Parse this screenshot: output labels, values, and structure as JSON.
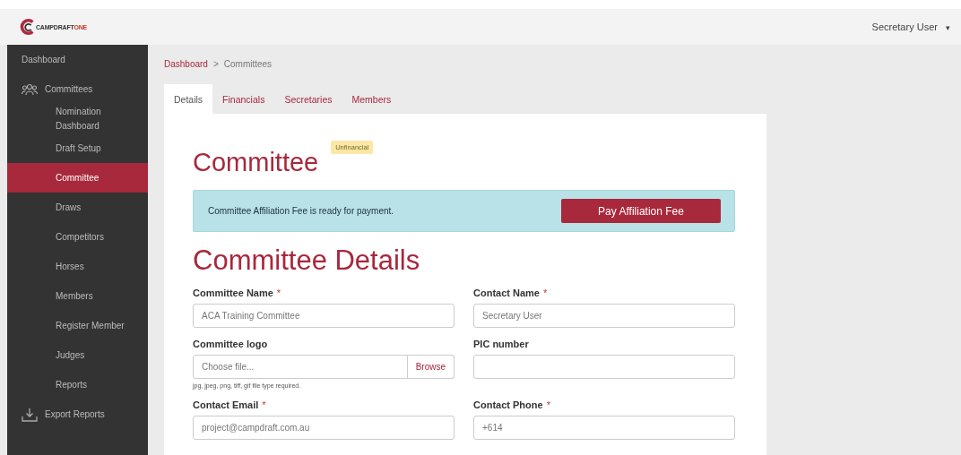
{
  "logo": {
    "text": "CAMPDRAFT",
    "accent": "ONE"
  },
  "user_menu": {
    "label": "Secretary User",
    "caret": "▾"
  },
  "sidebar": {
    "items": [
      {
        "label": "Dashboard",
        "kind": "plain",
        "selected": false
      },
      {
        "label": "Committees",
        "kind": "group",
        "selected": false
      },
      {
        "label": "Nomination Dashboard",
        "kind": "sub",
        "selected": false
      },
      {
        "label": "Draft Setup",
        "kind": "sub",
        "selected": false
      },
      {
        "label": "Committee",
        "kind": "sub",
        "selected": true
      },
      {
        "label": "Draws",
        "kind": "sub",
        "selected": false
      },
      {
        "label": "Competitors",
        "kind": "sub",
        "selected": false
      },
      {
        "label": "Horses",
        "kind": "sub",
        "selected": false
      },
      {
        "label": "Members",
        "kind": "sub",
        "selected": false
      },
      {
        "label": "Register Member",
        "kind": "sub",
        "selected": false
      },
      {
        "label": "Judges",
        "kind": "sub",
        "selected": false
      },
      {
        "label": "Reports",
        "kind": "sub",
        "selected": false
      },
      {
        "label": "Export Reports",
        "kind": "export",
        "selected": false
      }
    ]
  },
  "breadcrumb": [
    {
      "label": "Dashboard",
      "kind": "link"
    },
    {
      "label": ">",
      "kind": "separator"
    },
    {
      "label": "Committees",
      "kind": "current"
    }
  ],
  "tabs": [
    {
      "label": "Details",
      "selected": true
    },
    {
      "label": "Financials",
      "selected": false
    },
    {
      "label": "Secretaries",
      "selected": false
    },
    {
      "label": "Members",
      "selected": false
    }
  ],
  "title": "Committee",
  "badge": "Unfinancial",
  "alert": {
    "text": "Committee Affiliation Fee is ready for payment.",
    "button": "Pay Affiliation Fee"
  },
  "section_title": "Committee Details",
  "fields": [
    {
      "label": "Committee Name",
      "required_mark": "*",
      "kind": "text",
      "value": "ACA Training Committee"
    },
    {
      "label": "Contact Name",
      "required_mark": "*",
      "kind": "text",
      "value": "Secretary User"
    },
    {
      "label": "Committee logo",
      "kind": "file",
      "placeholder": "Choose file...",
      "button": "Browse",
      "help": "jpg, jpeg, png, tiff, gif file type required."
    },
    {
      "label": "PIC number",
      "kind": "text"
    },
    {
      "label": "Contact Email",
      "required_mark": "*",
      "kind": "text",
      "value": "project@campdraft.com.au"
    },
    {
      "label": "Contact Phone",
      "required_mark": "*",
      "kind": "text",
      "value": "+614"
    }
  ]
}
